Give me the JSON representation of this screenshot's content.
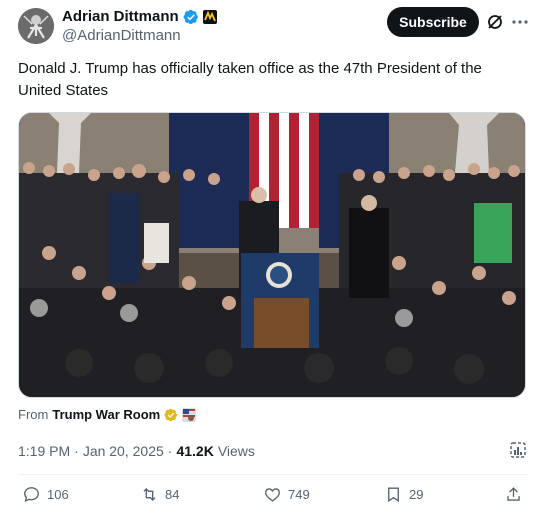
{
  "author": {
    "display_name": "Adrian Dittmann",
    "handle": "@AdrianDittmann",
    "verified_color": "#1d9bf0"
  },
  "header": {
    "subscribe_label": "Subscribe",
    "grok_icon": "grok-icon",
    "more_icon": "more-icon"
  },
  "tweet": {
    "text": "Donald J. Trump has officially taken office as the 47th President of the United States"
  },
  "media": {
    "description_icon": "video-thumbnail"
  },
  "source": {
    "prefix": "From",
    "name": "Trump War Room"
  },
  "meta": {
    "time": "1:19 PM",
    "separator": "·",
    "date": "Jan 20, 2025",
    "separator2": "·",
    "views_count": "41.2K",
    "views_label": "Views"
  },
  "actions": {
    "replies": "106",
    "reposts": "84",
    "likes": "749",
    "bookmarks": "29"
  },
  "colors": {
    "text_primary": "#0f1419",
    "text_secondary": "#536471",
    "subscribe_bg": "#0f1419"
  }
}
